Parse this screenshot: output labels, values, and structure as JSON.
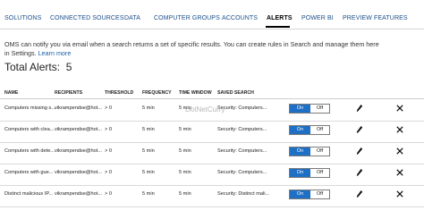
{
  "tabs": [
    {
      "label": "SOLUTIONS"
    },
    {
      "label": "CONNECTED SOURCES"
    },
    {
      "label": "DATA"
    },
    {
      "label": "COMPUTER GROUPS"
    },
    {
      "label": "ACCOUNTS"
    },
    {
      "label": "ALERTS"
    },
    {
      "label": "POWER BI"
    },
    {
      "label": "PREVIEW FEATURES"
    }
  ],
  "active_tab": "ALERTS",
  "intro": {
    "text": "OMS can notify you via email when a search returns a set of specific results. You can create rules in Search and manage them here in Settings.",
    "link": "Learn more"
  },
  "total": {
    "label": "Total Alerts:",
    "count": "5"
  },
  "columns": [
    "NAME",
    "RECIPIENTS",
    "THRESHOLD",
    "FREQUENCY",
    "TIME WINDOW",
    "SAVED SEARCH"
  ],
  "rows": [
    {
      "name": "Computers missing s...",
      "recipients": "vikrampendse@hot...",
      "threshold": "> 0",
      "frequency": "5 min",
      "time_window": "5 min",
      "saved_search": "Security: Computers...",
      "toggle_on": "On",
      "toggle_off": "Off"
    },
    {
      "name": "Computers with clea...",
      "recipients": "vikrampendse@hot...",
      "threshold": "> 0",
      "frequency": "5 min",
      "time_window": "5 min",
      "saved_search": "Security: Computers...",
      "toggle_on": "On",
      "toggle_off": "Off"
    },
    {
      "name": "Computers with dete...",
      "recipients": "vikrampendse@hot...",
      "threshold": "> 0",
      "frequency": "5 min",
      "time_window": "5 min",
      "saved_search": "Security: Computers...",
      "toggle_on": "On",
      "toggle_off": "Off"
    },
    {
      "name": "Computers with gue...",
      "recipients": "vikrampendse@hot...",
      "threshold": "> 0",
      "frequency": "5 min",
      "time_window": "5 min",
      "saved_search": "Security: Computers...",
      "toggle_on": "On",
      "toggle_off": "Off"
    },
    {
      "name": "Distinct malicious IP...",
      "recipients": "vikrampendse@hot...",
      "threshold": "> 0",
      "frequency": "5 min",
      "time_window": "5 min",
      "saved_search": "Security: Distinct mali...",
      "toggle_on": "On",
      "toggle_off": "Off"
    }
  ],
  "icons": {
    "edit": "pencil-icon",
    "delete": "close-icon"
  },
  "watermark": "DotNetCurry",
  "colors": {
    "accent": "#1f6fc5",
    "tab_text": "#1b4f8a",
    "link": "#1b5fa8"
  }
}
